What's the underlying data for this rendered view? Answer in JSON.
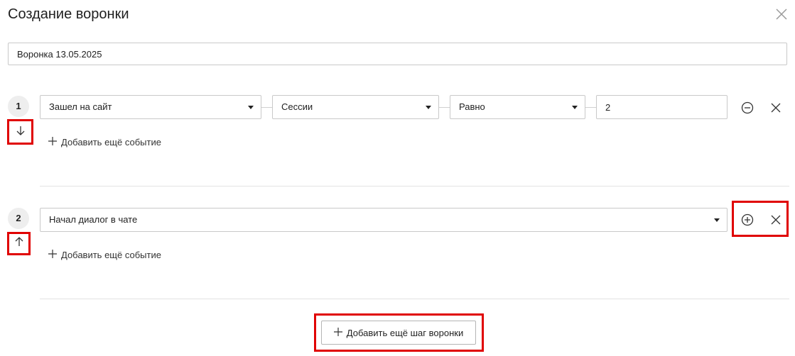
{
  "dialog": {
    "title": "Создание воронки",
    "close_icon": "close-icon"
  },
  "funnel_name": {
    "value": "Воронка 13.05.2025"
  },
  "steps": [
    {
      "number": "1",
      "move_icon": "arrow-down-icon",
      "event": "Зашел на сайт",
      "parameter": "Сессии",
      "operator": "Равно",
      "value": "2",
      "action_icon": "minus-circle-icon",
      "remove_icon": "close-icon",
      "add_event_label": "Добавить ещё событие"
    },
    {
      "number": "2",
      "move_icon": "arrow-up-icon",
      "event": "Начал диалог в чате",
      "action_icon": "plus-circle-icon",
      "remove_icon": "close-icon",
      "add_event_label": "Добавить ещё событие"
    }
  ],
  "add_step": {
    "label": "Добавить ещё шаг воронки",
    "icon": "plus-icon"
  },
  "colors": {
    "highlight": "#e00000",
    "border": "#c9c9c9",
    "badge_bg": "#eeeeee"
  }
}
